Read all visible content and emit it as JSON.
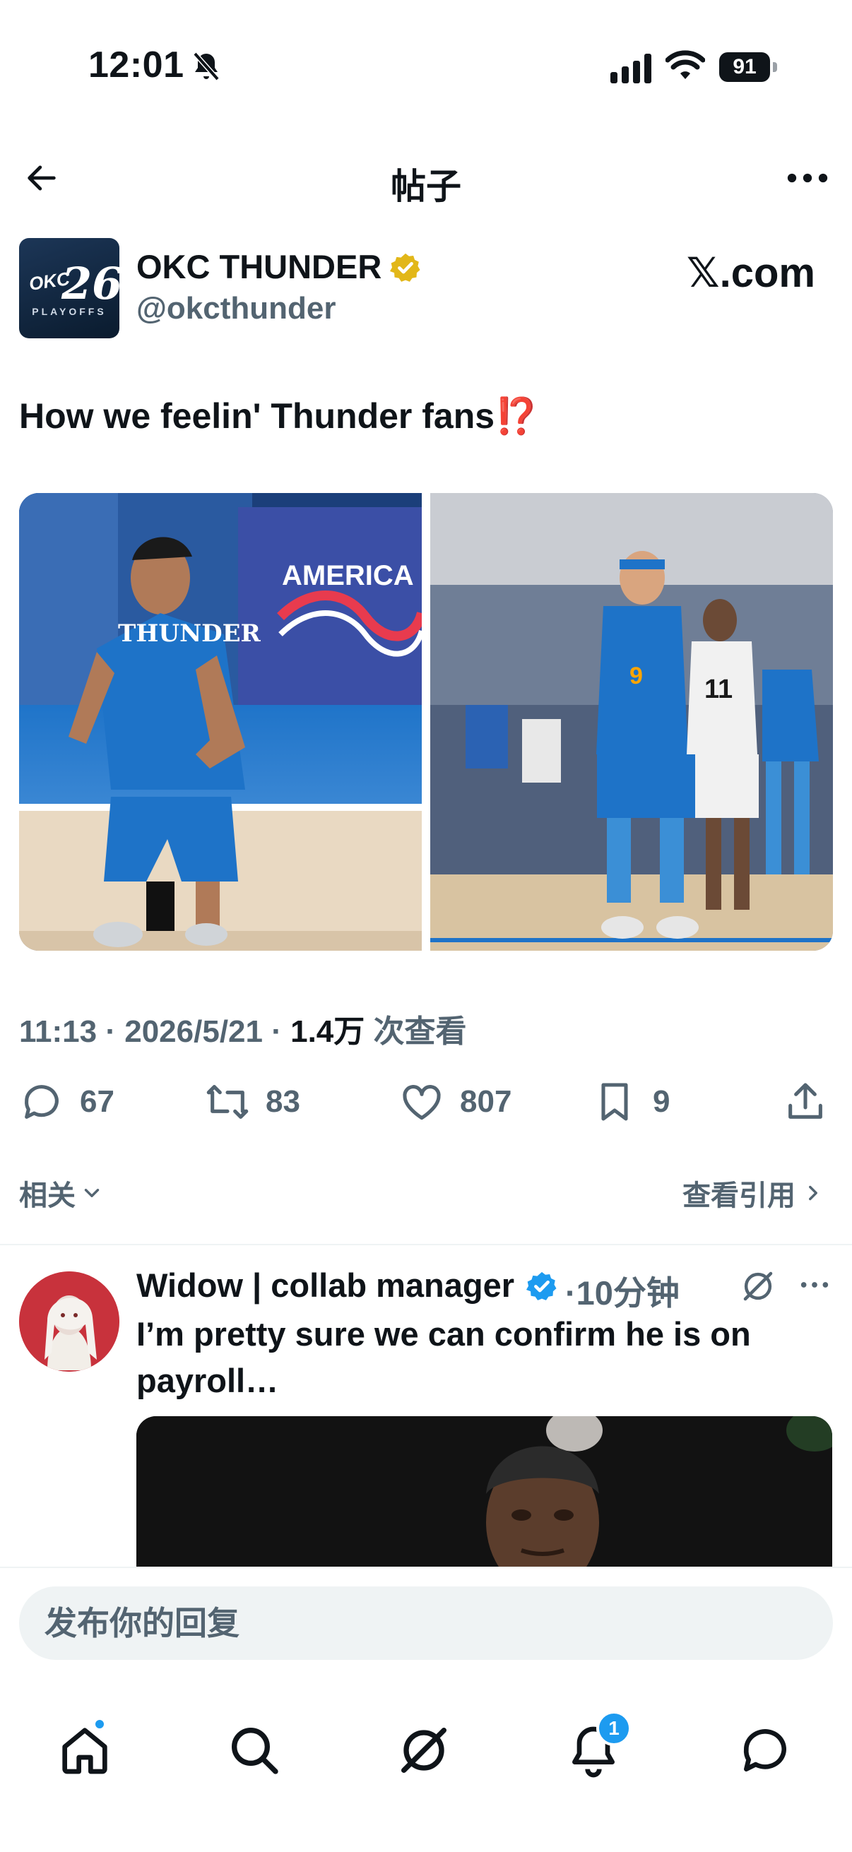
{
  "status_bar": {
    "time": "12:01",
    "battery": "91"
  },
  "header": {
    "title": "帖子"
  },
  "post": {
    "author_name": "OKC THUNDER",
    "author_handle": "@okcthunder",
    "avatar_number": "26",
    "avatar_brand": "OKC",
    "avatar_sub": "PLAYOFFS",
    "source_label": "𝕏.com",
    "text": "How we feelin' Thunder fans",
    "text_emoji": "⁉️",
    "time": "11:13",
    "date": "2026/5/21",
    "views_count": "1.4万",
    "views_label": "次查看",
    "separator": "·",
    "stats": {
      "replies": "67",
      "reposts": "83",
      "likes": "807",
      "bookmarks": "9"
    }
  },
  "filters": {
    "related": "相关",
    "view_quotes": "查看引用"
  },
  "reply": {
    "author_name": "Widow | collab manager",
    "time": "·10分钟",
    "text": "I’m pretty sure we can confirm he is on payroll…"
  },
  "reply_bar": {
    "placeholder": "发布你的回复"
  },
  "tabbar": {
    "notifications_badge": "1"
  },
  "colors": {
    "accent": "#1d9bf0",
    "secondary_text": "#536471",
    "thunder_blue": "#007ac1",
    "verified_gold": "#e2b719"
  }
}
